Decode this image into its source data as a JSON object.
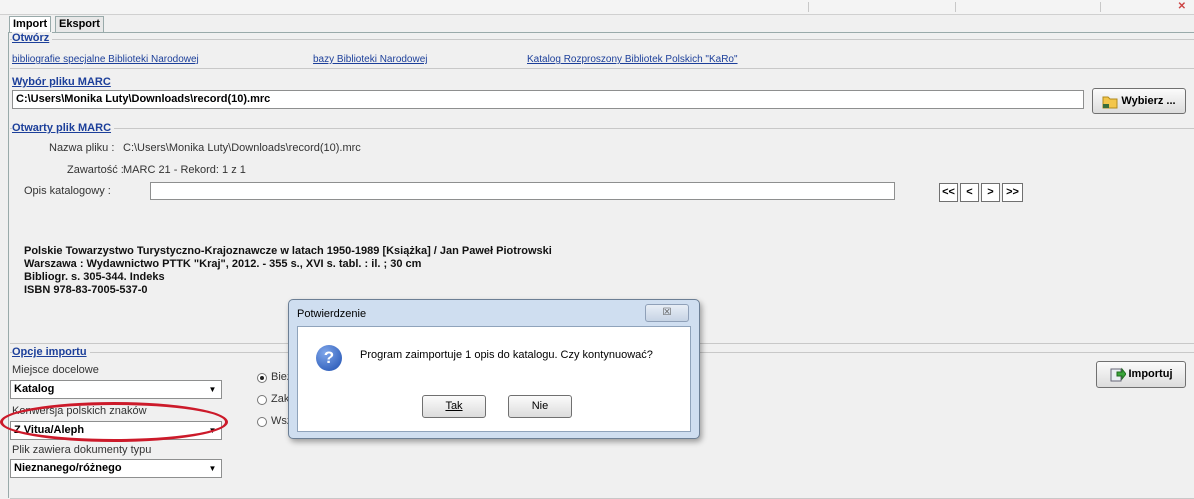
{
  "tabs": [
    "Import",
    "Eksport"
  ],
  "otworz": {
    "title": "Otwórz",
    "links": [
      "bibliografie specjalne Biblioteki Narodowej",
      "bazy Biblioteki Narodowej",
      "Katalog Rozproszony Bibliotek Polskich \"KaRo\""
    ]
  },
  "wybor": {
    "title": "Wybór pliku MARC",
    "path": "C:\\Users\\Monika Luty\\Downloads\\record(10).mrc",
    "button": "Wybierz ..."
  },
  "otwarty": {
    "title": "Otwarty plik MARC",
    "nazwa_label": "Nazwa pliku :",
    "nazwa_value": "C:\\Users\\Monika Luty\\Downloads\\record(10).mrc",
    "zawartosc_label": "Zawartość :",
    "zawartosc_value": "MARC 21 - Rekord: 1 z 1",
    "opis_label": "Opis katalogowy :",
    "nav": [
      "<<",
      "<",
      ">",
      ">>"
    ],
    "description": [
      "Polskie Towarzystwo Turystyczno-Krajoznawcze w latach 1950-1989 [Książka] / Jan Paweł Piotrowski",
      "Warszawa : Wydawnictwo PTTK \"Kraj\", 2012. - 355 s., XVI s. tabl. : il. ; 30 cm",
      "Bibliogr. s. 305-344. Indeks",
      "ISBN 978-83-7005-537-0"
    ]
  },
  "opcje": {
    "title": "Opcje importu",
    "miejsce_label": "Miejsce docelowe",
    "miejsce_value": "Katalog",
    "konwersja_label": "Konwersja polskich znaków",
    "konwersja_value": "Z Vitua/Aleph",
    "plik_label": "Plik zawiera dokumenty typu",
    "plik_value": "Nieznanego/różnego",
    "radios": [
      "Bież",
      "Zakr",
      "Wsz"
    ],
    "import_button": "Importuj"
  },
  "dialog": {
    "title": "Potwierdzenie",
    "close": "☒",
    "message": "Program zaimportuje 1 opis do katalogu. Czy kontynuować?",
    "yes": "Tak",
    "no": "Nie"
  },
  "colors": {
    "accent": "#1c3f9a",
    "highlight_circle": "#cc1a2a",
    "dialog_frame": "#cfdef0"
  }
}
